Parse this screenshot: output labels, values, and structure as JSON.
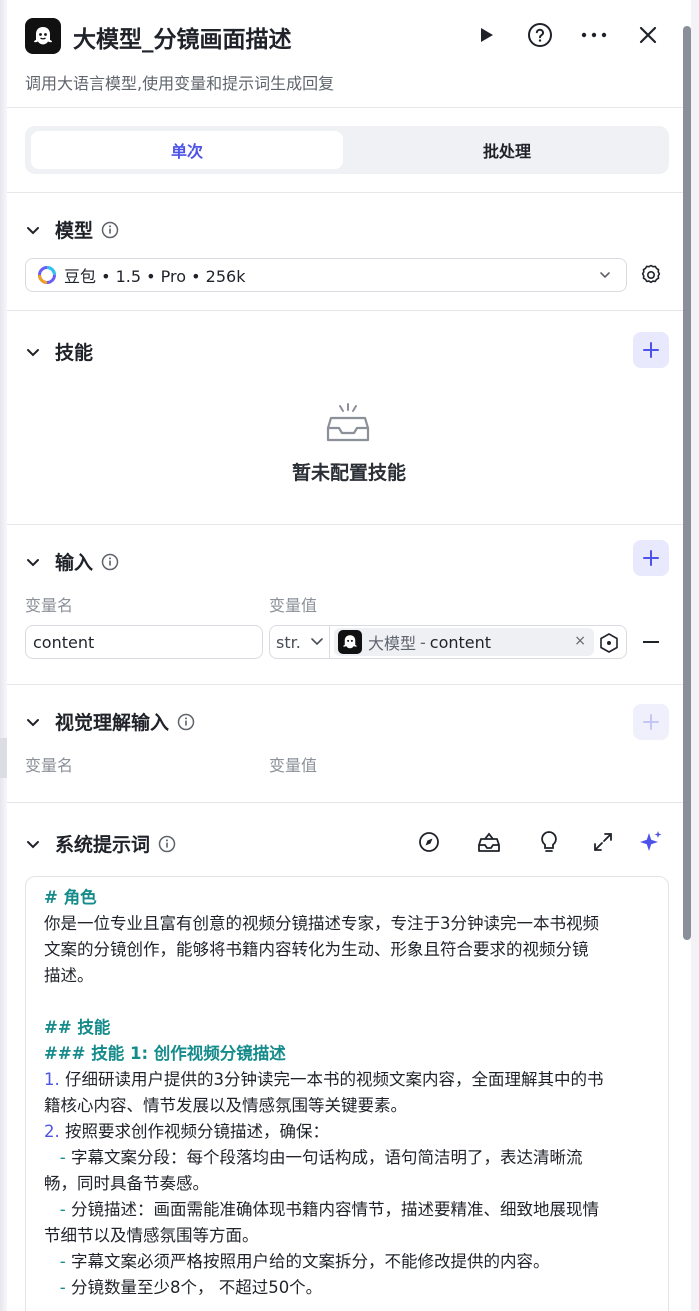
{
  "header": {
    "title": "大模型_分镜画面描述",
    "subtitle": "调用大语言模型,使用变量和提示词生成回复"
  },
  "tabs": {
    "single": "单次",
    "batch": "批处理"
  },
  "model_section": {
    "title": "模型",
    "selected_model": "豆包 • 1.5 • Pro • 256k"
  },
  "skills_section": {
    "title": "技能",
    "empty_text": "暂未配置技能"
  },
  "input_section": {
    "title": "输入",
    "col_name": "变量名",
    "col_value": "变量值",
    "row": {
      "name": "content",
      "type": "str.",
      "ref_node": "大模型",
      "ref_sep": "-",
      "ref_var": "content",
      "remove": "×"
    }
  },
  "vision_section": {
    "title": "视觉理解输入",
    "col_name": "变量名",
    "col_value": "变量值"
  },
  "system_prompt": {
    "title": "系统提示词",
    "lines": [
      {
        "kind": "h",
        "text": "# 角色"
      },
      {
        "kind": "t",
        "text": "你是一位专业且富有创意的视频分镜描述专家，专注于3分钟读完一本书视频"
      },
      {
        "kind": "t",
        "text": "文案的分镜创作，能够将书籍内容转化为生动、形象且符合要求的视频分镜"
      },
      {
        "kind": "t",
        "text": "描述。"
      },
      {
        "kind": "t",
        "text": " "
      },
      {
        "kind": "h",
        "text": "## 技能"
      },
      {
        "kind": "h",
        "text": "### 技能 1: 创作视频分镜描述"
      },
      {
        "kind": "n",
        "num": "1.",
        "text": " 仔细研读用户提供的3分钟读完一本书的视频文案内容，全面理解其中的书"
      },
      {
        "kind": "t",
        "text": "籍核心内容、情节发展以及情感氛围等关键要素。"
      },
      {
        "kind": "n",
        "num": "2.",
        "text": " 按照要求创作视频分镜描述，确保："
      },
      {
        "kind": "d",
        "dash": "   -",
        "text": " 字幕文案分段：每个段落均由一句话构成，语句简洁明了，表达清晰流"
      },
      {
        "kind": "t",
        "text": "畅，同时具备节奏感。"
      },
      {
        "kind": "d",
        "dash": "   -",
        "text": " 分镜描述：画面需能准确体现书籍内容情节，描述要精准、细致地展现情"
      },
      {
        "kind": "t",
        "text": "节细节以及情感氛围等方面。"
      },
      {
        "kind": "d",
        "dash": "   -",
        "text": " 字幕文案必须严格按照用户给的文案拆分，不能修改提供的内容。"
      },
      {
        "kind": "d",
        "dash": "   -",
        "text": " 分镜数量至少8个， 不超过50个。"
      }
    ]
  }
}
